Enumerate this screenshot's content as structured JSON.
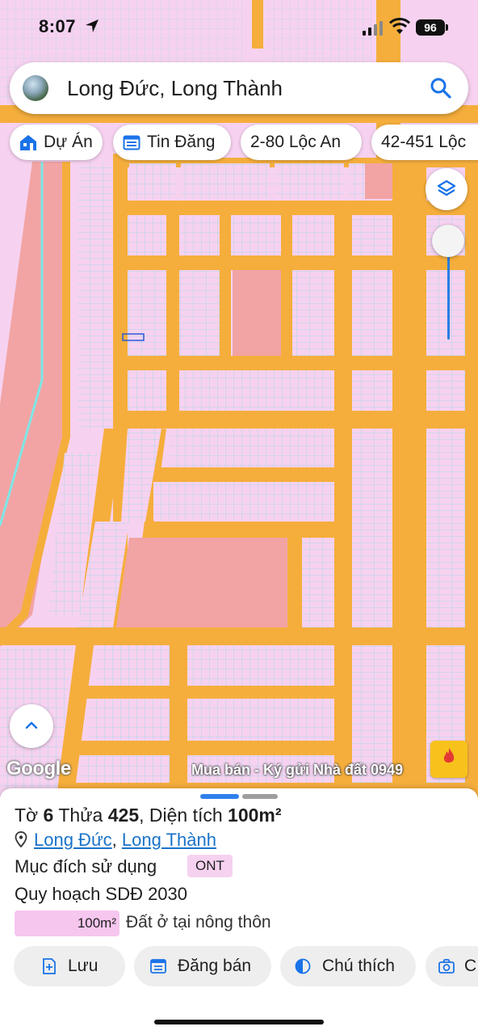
{
  "status_bar": {
    "time": "8:07",
    "battery": "96"
  },
  "search": {
    "query": "Long Đức, Long Thành"
  },
  "chips": [
    {
      "icon": "building-icon",
      "label": "Dự Án"
    },
    {
      "icon": "calendar-list-icon",
      "label": "Tin Đăng"
    },
    {
      "label": "2-80 Lộc An"
    },
    {
      "label": "42-451 Lộc"
    }
  ],
  "map": {
    "attribution": "Google",
    "watermark": "Mua bán - Ký gửi Nhà đất 0949",
    "colors": {
      "land": "#f6d2f0",
      "road": "#f5ae3c",
      "block_highlight": "#f2a4a4",
      "canal": "#7fe6e6"
    }
  },
  "sheet": {
    "sheet_label": "Tờ",
    "sheet_no": "6",
    "plot_label": "Thửa",
    "plot_no": "425",
    "area_label": "Diện tích",
    "area_value": "100m²",
    "ward": "Long Đức",
    "district": "Long Thành",
    "purpose_label": "Mục đích sử dụng",
    "purpose_code": "ONT",
    "plan_title": "Quy hoạch SDĐ 2030",
    "legend_area": "100m²",
    "legend_desc": "Đất ở tại nông thôn",
    "actions": [
      {
        "icon": "bookmark-add-icon",
        "label": "Lưu"
      },
      {
        "icon": "post-listing-icon",
        "label": "Đăng bán"
      },
      {
        "icon": "contrast-icon",
        "label": "Chú thích"
      },
      {
        "icon": "camera-icon",
        "label": "C"
      }
    ]
  }
}
